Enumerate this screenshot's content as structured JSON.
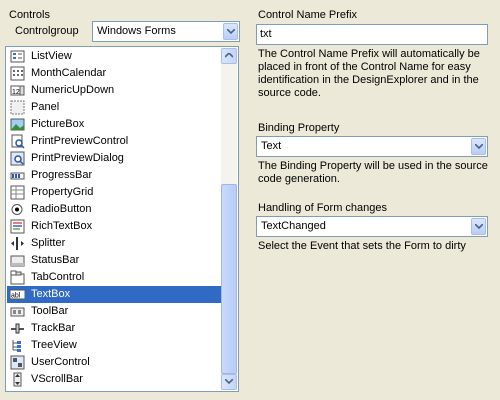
{
  "left": {
    "title": "Controls",
    "controlgroup_label": "Controlgroup",
    "controlgroup_value": "Windows Forms",
    "items": [
      {
        "label": "ListView",
        "icon": "listview-icon"
      },
      {
        "label": "MonthCalendar",
        "icon": "monthcalendar-icon"
      },
      {
        "label": "NumericUpDown",
        "icon": "numericupdown-icon"
      },
      {
        "label": "Panel",
        "icon": "panel-icon"
      },
      {
        "label": "PictureBox",
        "icon": "picturebox-icon"
      },
      {
        "label": "PrintPreviewControl",
        "icon": "printpreviewcontrol-icon"
      },
      {
        "label": "PrintPreviewDialog",
        "icon": "printpreviewdialog-icon"
      },
      {
        "label": "ProgressBar",
        "icon": "progressbar-icon"
      },
      {
        "label": "PropertyGrid",
        "icon": "propertygrid-icon"
      },
      {
        "label": "RadioButton",
        "icon": "radiobutton-icon"
      },
      {
        "label": "RichTextBox",
        "icon": "richtextbox-icon"
      },
      {
        "label": "Splitter",
        "icon": "splitter-icon"
      },
      {
        "label": "StatusBar",
        "icon": "statusbar-icon"
      },
      {
        "label": "TabControl",
        "icon": "tabcontrol-icon"
      },
      {
        "label": "TextBox",
        "icon": "textbox-icon",
        "selected": true
      },
      {
        "label": "ToolBar",
        "icon": "toolbar-icon"
      },
      {
        "label": "TrackBar",
        "icon": "trackbar-icon"
      },
      {
        "label": "TreeView",
        "icon": "treeview-icon"
      },
      {
        "label": "UserControl",
        "icon": "usercontrol-icon"
      },
      {
        "label": "VScrollBar",
        "icon": "vscrollbar-icon"
      }
    ]
  },
  "right": {
    "prefix_label": "Control Name Prefix",
    "prefix_value": "txt",
    "prefix_desc": "The Control Name Prefix will automatically be placed in front of the Control Name for easy identification in the DesignExplorer and in the source code.",
    "binding_label": "Binding Property",
    "binding_value": "Text",
    "binding_desc": "The Binding Property will  be used in the source code generation.",
    "formchange_label": "Handling of Form changes",
    "formchange_value": "TextChanged",
    "formchange_desc": "Select the Event that sets the Form to dirty"
  },
  "colors": {
    "selection": "#316ac5",
    "background": "#ece9d8",
    "border": "#7f9db9"
  }
}
